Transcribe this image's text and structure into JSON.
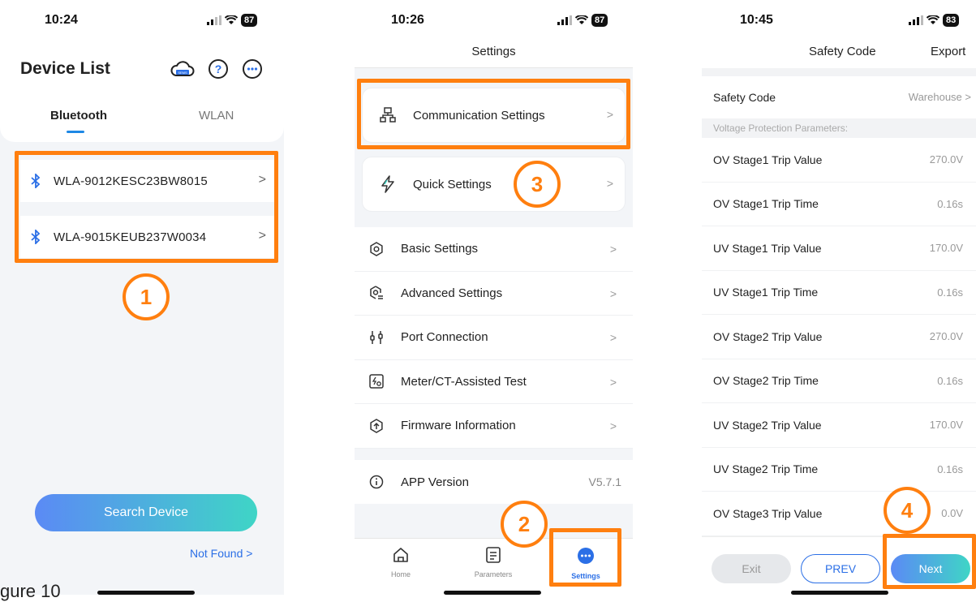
{
  "colors": {
    "highlight": "#ff7f0f",
    "accent": "#2b6fe6",
    "gradient_start": "#5b8af5",
    "gradient_end": "#3fd5c6"
  },
  "figure_label": "gure 10",
  "screen1": {
    "time": "10:24",
    "battery": "87",
    "title": "Device List",
    "header_icons": [
      "sems-cloud-icon",
      "help-icon",
      "more-icon"
    ],
    "cloud_icon_text": "SEMS",
    "tabs": [
      "Bluetooth",
      "WLAN"
    ],
    "active_tab": "Bluetooth",
    "devices": [
      "WLA-9012KESC23BW8015",
      "WLA-9015KEUB237W0034"
    ],
    "search_button": "Search Device",
    "not_found": "Not Found >",
    "step_marker": "1"
  },
  "screen2": {
    "time": "10:26",
    "battery": "87",
    "title": "Settings",
    "cards": [
      {
        "label": "Communication Settings",
        "icon": "network-icon"
      },
      {
        "label": "Quick Settings",
        "icon": "lightning-icon"
      }
    ],
    "items": [
      {
        "label": "Basic Settings",
        "icon": "gear-icon"
      },
      {
        "label": "Advanced Settings",
        "icon": "advanced-gear-icon"
      },
      {
        "label": "Port Connection",
        "icon": "port-icon"
      },
      {
        "label": "Meter/CT-Assisted Test",
        "icon": "meter-test-icon"
      },
      {
        "label": "Firmware Information",
        "icon": "firmware-icon"
      }
    ],
    "app_version_label": "APP Version",
    "app_version_value": "V5.7.1",
    "tabbar": [
      {
        "label": "Home",
        "icon": "home-icon"
      },
      {
        "label": "Parameters",
        "icon": "parameters-icon"
      },
      {
        "label": "Settings",
        "icon": "settings-dots-icon"
      }
    ],
    "active_tab": "Settings",
    "step_markers": [
      "3",
      "2"
    ]
  },
  "screen3": {
    "time": "10:45",
    "battery": "83",
    "title": "Safety Code",
    "export": "Export",
    "safety_code_label": "Safety Code",
    "safety_code_value": "Warehouse",
    "section_header": "Voltage Protection Parameters:",
    "params": [
      {
        "label": "OV Stage1 Trip Value",
        "value": "270.0V"
      },
      {
        "label": "OV Stage1 Trip Time",
        "value": "0.16s"
      },
      {
        "label": "UV Stage1 Trip Value",
        "value": "170.0V"
      },
      {
        "label": "UV Stage1 Trip Time",
        "value": "0.16s"
      },
      {
        "label": "OV Stage2 Trip Value",
        "value": "270.0V"
      },
      {
        "label": "OV Stage2 Trip Time",
        "value": "0.16s"
      },
      {
        "label": "UV Stage2 Trip Value",
        "value": "170.0V"
      },
      {
        "label": "UV Stage2 Trip Time",
        "value": "0.16s"
      },
      {
        "label": "OV Stage3 Trip Value",
        "value": "0.0V"
      }
    ],
    "buttons": {
      "exit": "Exit",
      "prev": "PREV",
      "next": "Next"
    },
    "step_marker": "4"
  }
}
